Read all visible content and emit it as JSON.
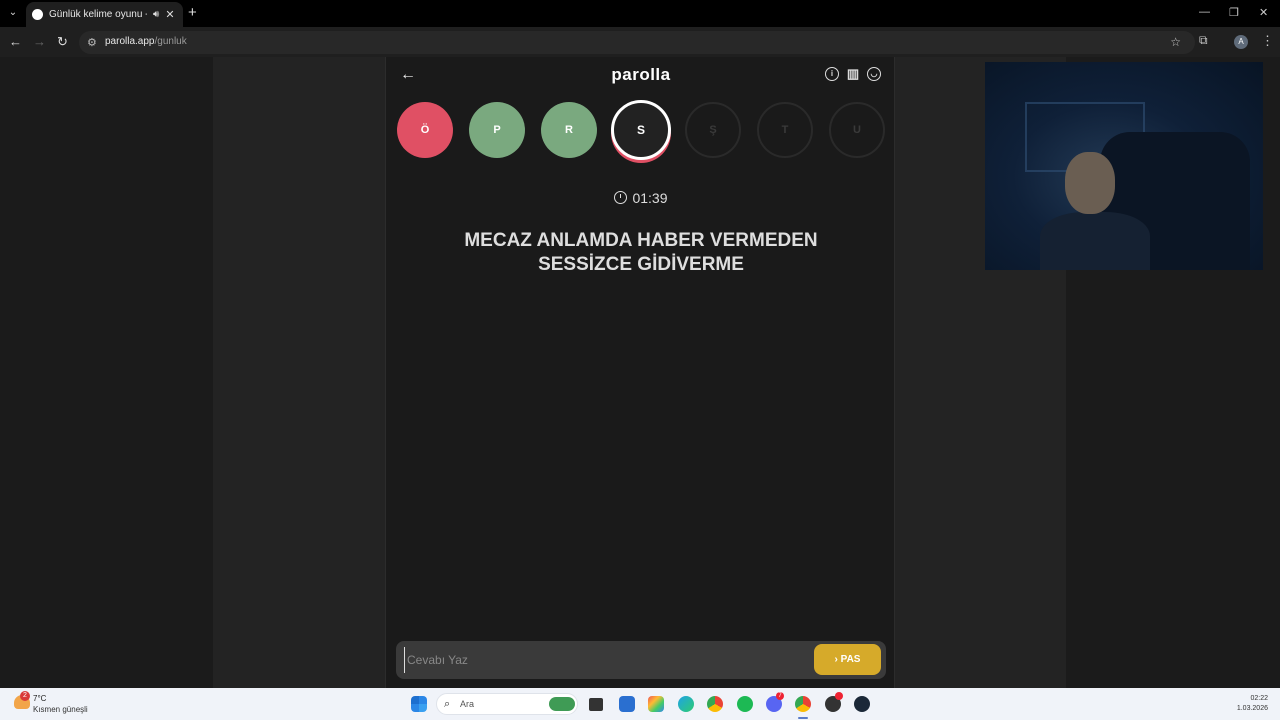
{
  "browser": {
    "tab_title": "Günlük kelime oyunu - par",
    "url_host": "parolla.app",
    "url_path": "/gunluk",
    "profile_initial": "A"
  },
  "app": {
    "logo": "parolla",
    "letters": [
      {
        "letter": "Ö",
        "state": "wrong"
      },
      {
        "letter": "P",
        "state": "correct"
      },
      {
        "letter": "R",
        "state": "correct"
      },
      {
        "letter": "S",
        "state": "current"
      },
      {
        "letter": "Ş",
        "state": "pending"
      },
      {
        "letter": "T",
        "state": "pending"
      },
      {
        "letter": "U",
        "state": "pending"
      }
    ],
    "timer": "01:39",
    "question_line1": "MECAZ ANLAMDA HABER VERMEDEN",
    "question_line2": "SESSİZCE GİDİVERME",
    "answer_placeholder": "Cevabı Yaz",
    "pass_label": "PAS"
  },
  "taskbar": {
    "weather_temp": "7°C",
    "weather_desc": "Kısmen güneşli",
    "weather_badge": "2",
    "search_label": "Ara",
    "time": "02:22",
    "date": "1.03.2026",
    "discord_badge": "7"
  },
  "colors": {
    "wrong": "#e05064",
    "correct": "#7aa97f",
    "pass_button": "#d6aa2a"
  }
}
